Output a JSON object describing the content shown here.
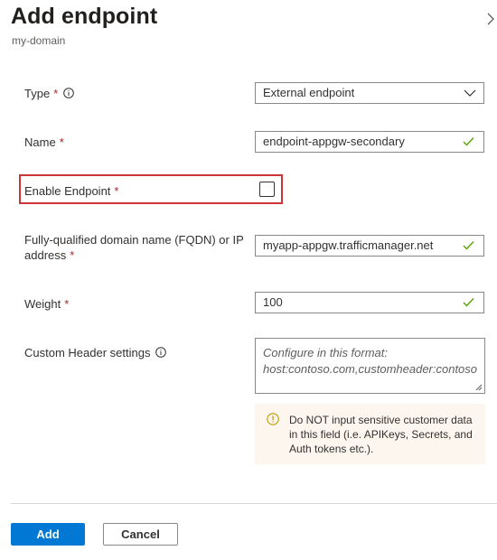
{
  "header": {
    "title": "Add endpoint",
    "subtitle": "my-domain"
  },
  "form": {
    "type": {
      "label": "Type",
      "value": "External endpoint"
    },
    "name": {
      "label": "Name",
      "value": "endpoint-appgw-secondary"
    },
    "enable_endpoint": {
      "label": "Enable Endpoint",
      "checked": false
    },
    "fqdn": {
      "label_line1": "Fully-qualified domain name (FQDN) or IP",
      "label_line2": "address",
      "value": "myapp-appgw.trafficmanager.net"
    },
    "weight": {
      "label": "Weight",
      "value": "100"
    },
    "custom_header": {
      "label": "Custom Header settings",
      "placeholder_line1": "Configure in this format:",
      "placeholder_line2": "host:contoso.com,customheader:contoso"
    },
    "required_marker": "*"
  },
  "warning": {
    "text": "Do NOT input sensitive customer data in this field (i.e. APIKeys, Secrets, and Auth tokens etc.)."
  },
  "footer": {
    "add_label": "Add",
    "cancel_label": "Cancel"
  },
  "colors": {
    "accent": "#0078d4",
    "success": "#57a300",
    "error": "#d13438",
    "warning": "#c19c00",
    "warning_bg": "#fdf6ee"
  }
}
